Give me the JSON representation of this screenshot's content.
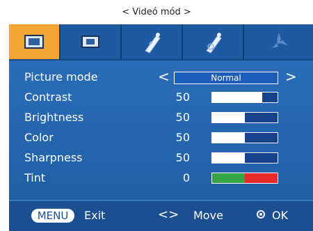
{
  "window": {
    "title": "< Videó mód >"
  },
  "tabs": [
    {
      "icon": "picture-tv-icon",
      "active": true
    },
    {
      "icon": "screen-tv-icon",
      "active": false
    },
    {
      "icon": "sound-tag-icon",
      "active": false
    },
    {
      "icon": "time-tag-icon",
      "active": false
    },
    {
      "icon": "option-fan-icon",
      "active": false
    }
  ],
  "settings": {
    "picture_mode": {
      "label": "Picture mode",
      "value": "Normal",
      "left": "<",
      "right": ">"
    },
    "rows": [
      {
        "label": "Contrast",
        "value": "50",
        "level": 0.77
      },
      {
        "label": "Brightness",
        "value": "50",
        "level": 0.5
      },
      {
        "label": "Color",
        "value": "50",
        "level": 0.5
      },
      {
        "label": "Sharpness",
        "value": "50",
        "level": 0.5
      }
    ],
    "tint": {
      "label": "Tint",
      "value": "0"
    }
  },
  "footer": {
    "menu_label": "MENU",
    "exit_label": "Exit",
    "move_arrows": "<>",
    "move_label": "Move",
    "ok_label": "OK"
  },
  "colors": {
    "osd_blue": "#1f5fa6",
    "active_tab": "#f2a533",
    "tint_green": "#37a745",
    "tint_red": "#e72b2b"
  }
}
